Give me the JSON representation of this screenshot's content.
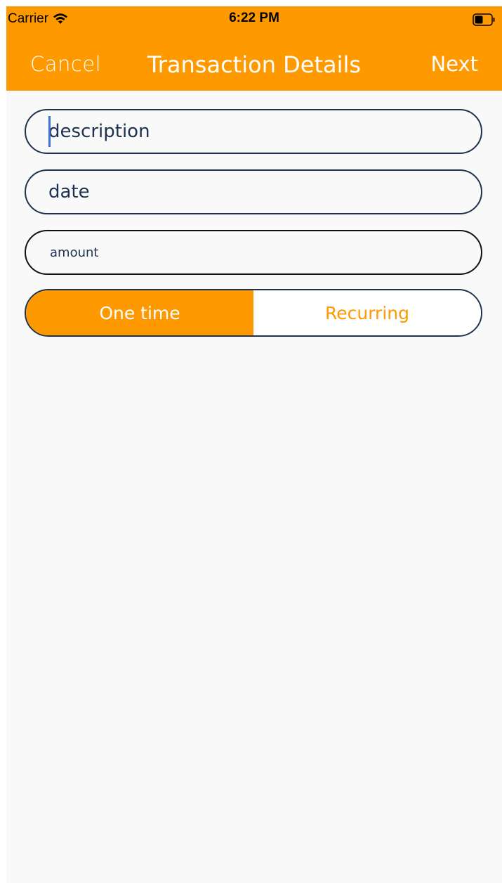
{
  "status_bar": {
    "carrier": "Carrier",
    "time": "6:22 PM",
    "icons": [
      "wifi-icon",
      "battery-icon"
    ]
  },
  "nav": {
    "cancel_label": "Cancel",
    "title": "Transaction Details",
    "next_label": "Next"
  },
  "form": {
    "description": {
      "value": "",
      "placeholder": "description"
    },
    "date": {
      "value": "",
      "placeholder": "date"
    },
    "amount": {
      "value": "",
      "placeholder": "amount"
    }
  },
  "frequency": {
    "options": [
      "One time",
      "Recurring"
    ],
    "selected": "One time"
  },
  "colors": {
    "accent": "#ff9900",
    "border": "#1e3250",
    "background": "#f9f9f9",
    "cursor": "#3b6ed6"
  }
}
